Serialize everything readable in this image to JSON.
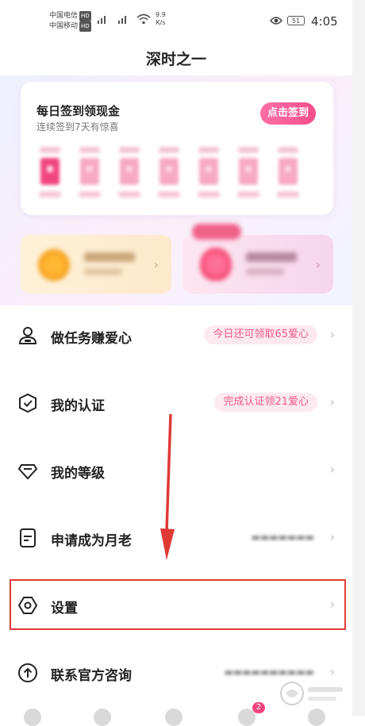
{
  "status": {
    "carrier1": "中国电信",
    "carrier2": "中国移动",
    "hd": "HD",
    "net1": "4G",
    "net2": "4G",
    "speed_value": "9.9",
    "speed_unit": "K/s",
    "battery": "51",
    "time": "4:05"
  },
  "page": {
    "title": "深时之一"
  },
  "checkin": {
    "title": "每日签到领现金",
    "subtitle": "连续签到7天有惊喜",
    "button": "点击签到"
  },
  "menu": [
    {
      "label": "做任务赚爱心",
      "badge": "今日还可领取65爱心",
      "icon": "person-task-icon"
    },
    {
      "label": "我的认证",
      "badge": "完成认证领21爱心",
      "icon": "shield-check-icon"
    },
    {
      "label": "我的等级",
      "badge": "",
      "icon": "diamond-icon"
    },
    {
      "label": "申请成为月老",
      "badge": "",
      "icon": "document-icon"
    },
    {
      "label": "设置",
      "badge": "",
      "icon": "hexagon-settings-icon"
    },
    {
      "label": "联系官方咨询",
      "badge": "",
      "icon": "arrow-up-circle-icon"
    }
  ],
  "nav": {
    "message_badge": "2"
  },
  "colors": {
    "accent": "#f54e8b",
    "annotation_red": "#e03a36",
    "badge_bg": "#fdeaf0"
  }
}
